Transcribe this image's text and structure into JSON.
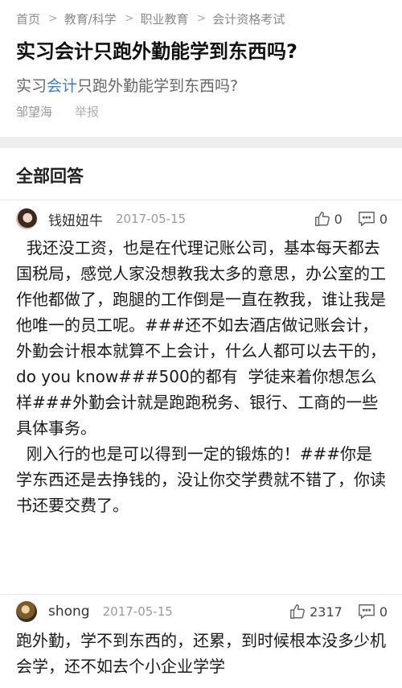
{
  "breadcrumb": {
    "items": [
      "首页",
      "教育/科学",
      "职业教育",
      "会计资格考试"
    ]
  },
  "question": {
    "title": "实习会计只跑外勤能学到东西吗?",
    "desc_before": "实习",
    "desc_keyword": "会计",
    "desc_after": "只跑外勤能学到东西吗?",
    "author": "邹望海",
    "report_label": "举报"
  },
  "answers_header": "全部回答",
  "answers": [
    {
      "username": "钱妞妞牛",
      "date": "2017-05-15",
      "likes": "0",
      "comments": "0",
      "body": "  我还没工资，也是在代理记账公司，基本每天都去国税局，感觉人家没想教我太多的意思，办公室的工作他都做了，跑腿的工作倒是一直在教我，谁让我是他唯一的员工呢。###还不如去酒店做记账会计，外勤会计根本就算不上会计，什么人都可以去干的，do you know###500的都有  学徒来着你想怎么样###外勤会计就是跑跑税务、银行、工商的一些具体事务。\n  刚入行的也是可以得到一定的锻炼的！###你是学东西还是去挣钱的，没让你交学费就不错了，你读书还要交费了。"
    },
    {
      "username": "shong",
      "date": "2017-05-15",
      "likes": "2317",
      "comments": "0",
      "body": "跑外勤，学不到东西的，还累，到时候根本没多少机会学，还不如去个小企业学学"
    }
  ],
  "colors": {
    "keyword": "#3c7ec8",
    "muted": "#8a8a8a",
    "band": "#eeeeee"
  },
  "icons": [
    "chevron-right-icon",
    "thumbs-up-icon",
    "comment-icon"
  ]
}
